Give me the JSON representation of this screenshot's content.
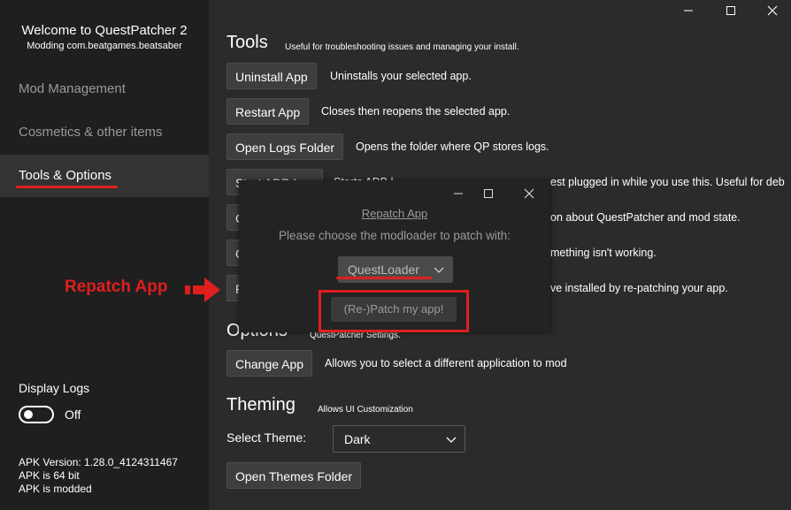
{
  "app": {
    "title": "Welcome to QuestPatcher 2",
    "subtitle": "Modding com.beatgames.beatsaber"
  },
  "nav": [
    {
      "label": "Mod Management"
    },
    {
      "label": "Cosmetics & other items"
    },
    {
      "label": "Tools & Options"
    }
  ],
  "sidebar_footer": {
    "display_logs_label": "Display Logs",
    "display_logs_state": "Off",
    "apk_version": "APK Version: 1.28.0_4124311467",
    "apk_bits": "APK is 64 bit",
    "apk_modded": "APK is modded"
  },
  "tools": {
    "title": "Tools",
    "note": "Useful for troubleshooting issues and managing your install.",
    "uninstall_label": "Uninstall App",
    "uninstall_desc": "Uninstalls your selected app.",
    "restart_label": "Restart App",
    "restart_desc": "Closes then reopens the selected app.",
    "logs_folder_label": "Open Logs Folder",
    "logs_folder_desc": "Opens the folder where QP stores logs.",
    "adb_label": "Start ADB Log",
    "adb_desc_pre": "Starts ADB l",
    "adb_desc_post": "est plugged in while you use this. Useful for deb",
    "row5_btn": "C",
    "row5_desc": "on about QuestPatcher and mod state.",
    "row6_btn": "C",
    "row6_desc": "mething isn't working.",
    "row7_btn": "R",
    "row7_desc": "ve installed by re-patching your app."
  },
  "options": {
    "title": "Options",
    "note": "QuestPatcher Settings.",
    "change_app_label": "Change App",
    "change_app_desc": "Allows you to select a different application to mod"
  },
  "theming": {
    "title": "Theming",
    "note": "Allows UI Customization",
    "select_label": "Select Theme:",
    "selected_theme": "Dark",
    "open_folder_label": "Open Themes Folder"
  },
  "dialog": {
    "title": "Repatch App",
    "prompt": "Please choose the modloader to patch with:",
    "modloader": "QuestLoader",
    "patch_button": "(Re-)Patch my app!"
  },
  "annotation": {
    "label": "Repatch App"
  },
  "colors": {
    "sidebar_bg": "#1f1f1f",
    "main_bg": "#2b2b2b",
    "annotation_red": "#e01e1e"
  },
  "icons": [
    "minimize-icon",
    "maximize-icon",
    "close-icon",
    "chevron-down-icon",
    "arrow-right-icon"
  ]
}
